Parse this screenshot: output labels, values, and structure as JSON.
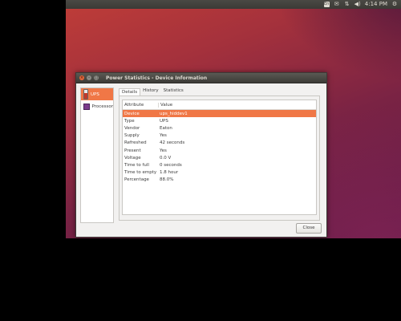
{
  "topbar": {
    "keyboard": "En",
    "mail": "✉",
    "volume": "◀)",
    "time": "4:14 PM",
    "gear": "⚙"
  },
  "window": {
    "title": "Power Statistics - Device Information"
  },
  "sidebar": {
    "items": [
      {
        "label": "UPS",
        "selected": true
      },
      {
        "label": "Processor",
        "selected": false
      }
    ]
  },
  "tabs": [
    {
      "label": "Details",
      "active": true
    },
    {
      "label": "History",
      "active": false
    },
    {
      "label": "Statistics",
      "active": false
    }
  ],
  "table": {
    "headers": [
      "Attribute",
      "Value"
    ],
    "rows": [
      {
        "attribute": "Device",
        "value": "ups_hiddev1",
        "selected": true
      },
      {
        "attribute": "Type",
        "value": "UPS"
      },
      {
        "attribute": "Vendor",
        "value": "Eaton"
      },
      {
        "attribute": "Supply",
        "value": "Yes"
      },
      {
        "attribute": "Refreshed",
        "value": "42 seconds"
      },
      {
        "attribute": "Present",
        "value": "Yes"
      },
      {
        "attribute": "Voltage",
        "value": "0.0 V"
      },
      {
        "attribute": "Time to full",
        "value": "0 seconds"
      },
      {
        "attribute": "Time to empty",
        "value": "1.8 hour"
      },
      {
        "attribute": "Percentage",
        "value": "88.0%"
      }
    ]
  },
  "buttons": {
    "close": "Close"
  },
  "colors": {
    "accent": "#f07746",
    "panel": "#3c3b37"
  }
}
